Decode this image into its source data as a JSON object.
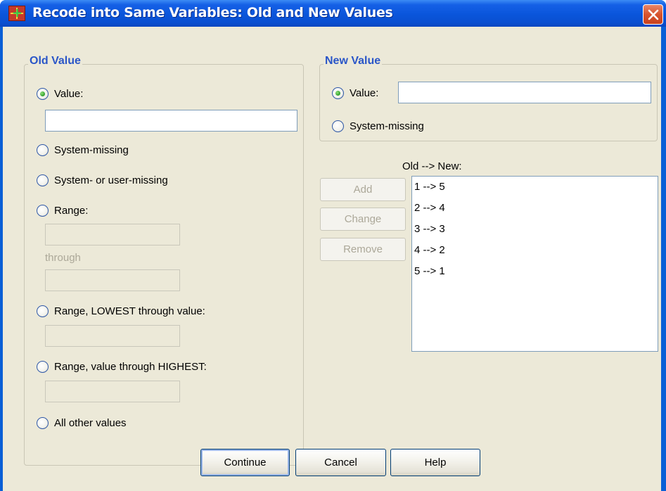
{
  "window": {
    "title": "Recode into Same Variables: Old and New Values"
  },
  "old_value": {
    "legend": "Old Value",
    "value_label": "Value:",
    "value_input": "",
    "system_missing_label": "System-missing",
    "system_user_missing_label": "System- or user-missing",
    "range_label": "Range:",
    "range_from": "",
    "through_label": "through",
    "range_to": "",
    "range_lowest_label": "Range, LOWEST through value:",
    "range_lowest_input": "",
    "range_highest_label": "Range, value through HIGHEST:",
    "range_highest_input": "",
    "all_other_label": "All other values",
    "selected": "Value:"
  },
  "new_value": {
    "legend": "New Value",
    "value_label": "Value:",
    "value_input": "",
    "system_missing_label": "System-missing",
    "selected": "Value:"
  },
  "mapping": {
    "label": "Old --> New:",
    "items": [
      "1 --> 5",
      "2 --> 4",
      "3 --> 3",
      "4 --> 2",
      "5 --> 1"
    ]
  },
  "list_buttons": {
    "add": "Add",
    "change": "Change",
    "remove": "Remove"
  },
  "footer": {
    "continue": "Continue",
    "cancel": "Cancel",
    "help": "Help"
  },
  "icons": {
    "app": "spss-recode-icon",
    "close": "close-icon"
  }
}
